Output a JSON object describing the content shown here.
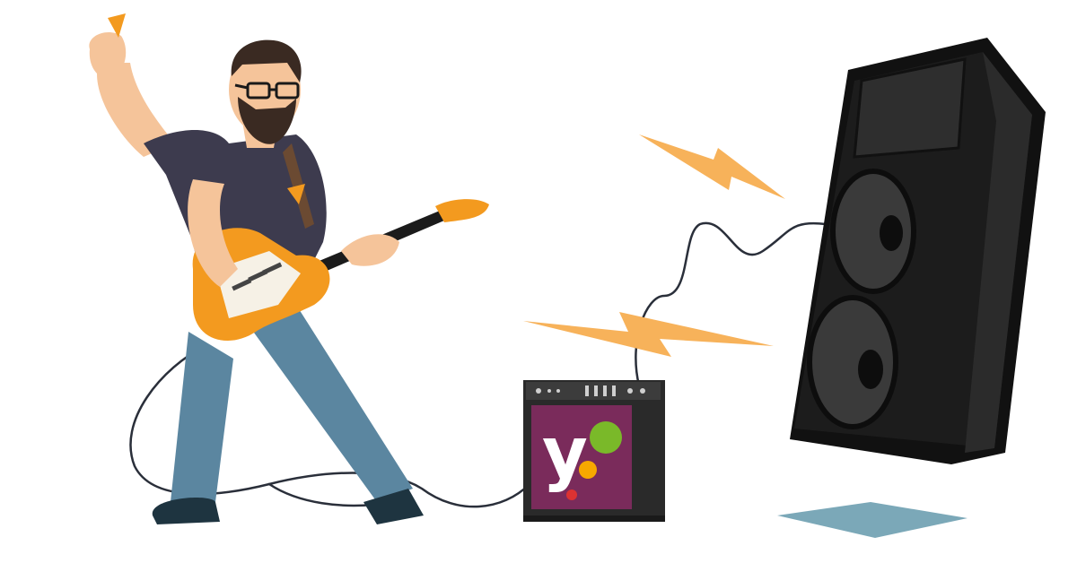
{
  "scene": {
    "subject": "guitarist-with-amp-and-speaker",
    "amp_logo_text": "y",
    "colors": {
      "background": "#ffffff",
      "guitar_body": "#f39a1f",
      "guitar_neck": "#1b1b1b",
      "shirt": "#3d3b4e",
      "jeans": "#5b86a0",
      "skin": "#f5c49a",
      "beard": "#3a2a22",
      "speaker": "#1c1c1c",
      "amp_panel": "#7a2b5b",
      "logo_green": "#7ab929",
      "logo_orange": "#f7a800",
      "logo_red": "#dc3232",
      "lightning": "#f7b25a",
      "floor_shadow": "#7ba8b8",
      "cable": "#2a2f3a"
    }
  }
}
